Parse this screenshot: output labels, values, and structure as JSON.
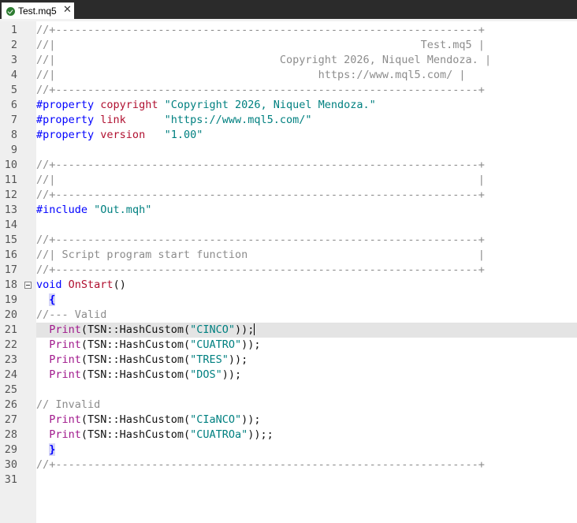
{
  "tab": {
    "title": "Test.mq5",
    "close": "✕",
    "status_icon": "check-circle"
  },
  "lines": [
    {
      "n": "1",
      "parts": [
        [
          "cmt",
          "//+------------------------------------------------------------------+"
        ]
      ]
    },
    {
      "n": "2",
      "parts": [
        [
          "cmt",
          "//|                                                         Test.mq5 |"
        ]
      ]
    },
    {
      "n": "3",
      "parts": [
        [
          "cmt",
          "//|                                   Copyright 2026, Niquel Mendoza. |"
        ]
      ]
    },
    {
      "n": "4",
      "parts": [
        [
          "cmt",
          "//|                                         https://www.mql5.com/ |"
        ]
      ]
    },
    {
      "n": "5",
      "parts": [
        [
          "cmt",
          "//+------------------------------------------------------------------+"
        ]
      ]
    },
    {
      "n": "6",
      "parts": [
        [
          "kw",
          "#property"
        ],
        [
          "dark",
          " "
        ],
        [
          "red",
          "copyright"
        ],
        [
          "dark",
          " "
        ],
        [
          "str",
          "\"Copyright 2026, Niquel Mendoza.\""
        ]
      ]
    },
    {
      "n": "7",
      "parts": [
        [
          "kw",
          "#property"
        ],
        [
          "dark",
          " "
        ],
        [
          "red",
          "link"
        ],
        [
          "dark",
          "      "
        ],
        [
          "str",
          "\"https://www.mql5.com/\""
        ]
      ]
    },
    {
      "n": "8",
      "parts": [
        [
          "kw",
          "#property"
        ],
        [
          "dark",
          " "
        ],
        [
          "red",
          "version"
        ],
        [
          "dark",
          "   "
        ],
        [
          "str",
          "\"1.00\""
        ]
      ]
    },
    {
      "n": "9",
      "parts": []
    },
    {
      "n": "10",
      "parts": [
        [
          "cmt",
          "//+------------------------------------------------------------------+"
        ]
      ]
    },
    {
      "n": "11",
      "parts": [
        [
          "cmt",
          "//|                                                                  |"
        ]
      ]
    },
    {
      "n": "12",
      "parts": [
        [
          "cmt",
          "//+------------------------------------------------------------------+"
        ]
      ]
    },
    {
      "n": "13",
      "parts": [
        [
          "kw",
          "#include"
        ],
        [
          "dark",
          " "
        ],
        [
          "str",
          "\"Out.mqh\""
        ]
      ]
    },
    {
      "n": "14",
      "parts": []
    },
    {
      "n": "15",
      "parts": [
        [
          "cmt",
          "//+------------------------------------------------------------------+"
        ]
      ]
    },
    {
      "n": "16",
      "parts": [
        [
          "cmt",
          "//| Script program start function                                    |"
        ]
      ]
    },
    {
      "n": "17",
      "parts": [
        [
          "cmt",
          "//+------------------------------------------------------------------+"
        ]
      ]
    },
    {
      "n": "18",
      "fold": true,
      "parts": [
        [
          "kw",
          "void"
        ],
        [
          "dark",
          " "
        ],
        [
          "red",
          "OnStart"
        ],
        [
          "dark",
          "()"
        ]
      ]
    },
    {
      "n": "19",
      "parts": [
        [
          "dark",
          "  "
        ],
        [
          "brace",
          "{"
        ]
      ]
    },
    {
      "n": "20",
      "parts": [
        [
          "cmt",
          "//--- Valid"
        ]
      ]
    },
    {
      "n": "21",
      "current": true,
      "caret": true,
      "parts": [
        [
          "dark",
          "  "
        ],
        [
          "fn",
          "Print"
        ],
        [
          "dark",
          "(TSN::HashCustom("
        ],
        [
          "str",
          "\"CINCO\""
        ],
        [
          "dark",
          "));"
        ]
      ]
    },
    {
      "n": "22",
      "parts": [
        [
          "dark",
          "  "
        ],
        [
          "fn",
          "Print"
        ],
        [
          "dark",
          "(TSN::HashCustom("
        ],
        [
          "str",
          "\"CUATRO\""
        ],
        [
          "dark",
          "));"
        ]
      ]
    },
    {
      "n": "23",
      "parts": [
        [
          "dark",
          "  "
        ],
        [
          "fn",
          "Print"
        ],
        [
          "dark",
          "(TSN::HashCustom("
        ],
        [
          "str",
          "\"TRES\""
        ],
        [
          "dark",
          "));"
        ]
      ]
    },
    {
      "n": "24",
      "parts": [
        [
          "dark",
          "  "
        ],
        [
          "fn",
          "Print"
        ],
        [
          "dark",
          "(TSN::HashCustom("
        ],
        [
          "str",
          "\"DOS\""
        ],
        [
          "dark",
          "));"
        ]
      ]
    },
    {
      "n": "25",
      "parts": []
    },
    {
      "n": "26",
      "parts": [
        [
          "cmt",
          "// Invalid"
        ]
      ]
    },
    {
      "n": "27",
      "parts": [
        [
          "dark",
          "  "
        ],
        [
          "fn",
          "Print"
        ],
        [
          "dark",
          "(TSN::HashCustom("
        ],
        [
          "str",
          "\"CIaNCO\""
        ],
        [
          "dark",
          "));"
        ]
      ]
    },
    {
      "n": "28",
      "parts": [
        [
          "dark",
          "  "
        ],
        [
          "fn",
          "Print"
        ],
        [
          "dark",
          "(TSN::HashCustom("
        ],
        [
          "str",
          "\"CUATROa\""
        ],
        [
          "dark",
          "));;"
        ]
      ]
    },
    {
      "n": "29",
      "parts": [
        [
          "dark",
          "  "
        ],
        [
          "brace",
          "}"
        ]
      ]
    },
    {
      "n": "30",
      "parts": [
        [
          "cmt",
          "//+------------------------------------------------------------------+"
        ]
      ]
    },
    {
      "n": "31",
      "parts": []
    }
  ]
}
